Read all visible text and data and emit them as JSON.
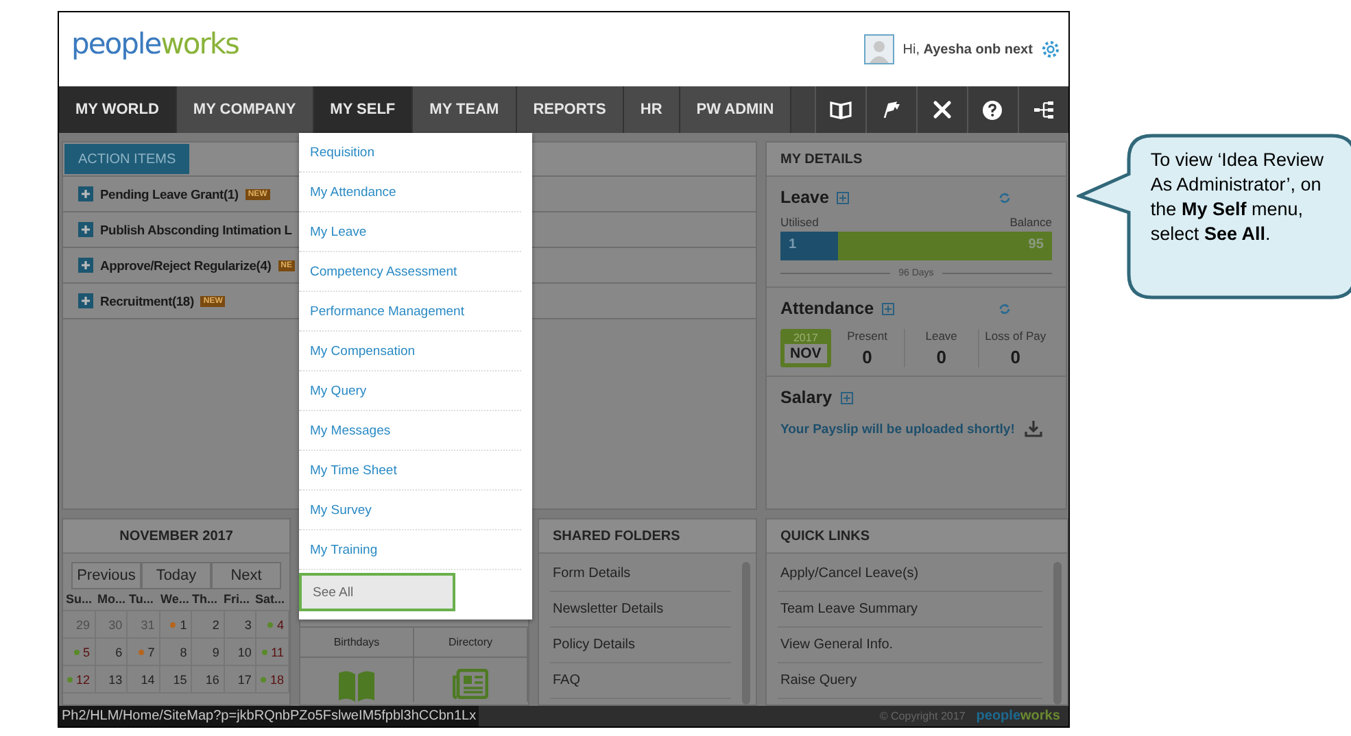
{
  "header": {
    "logo": [
      "people",
      "works"
    ],
    "greeting": "Hi, **Ayesha onb next**"
  },
  "nav": {
    "tabs": [
      {
        "label": "MY WORLD",
        "highlighted": true
      },
      {
        "label": "MY COMPANY",
        "highlighted": false
      },
      {
        "label": "MY SELF",
        "highlighted": true
      },
      {
        "label": "MY TEAM",
        "highlighted": false
      },
      {
        "label": "REPORTS",
        "highlighted": false
      },
      {
        "label": "HR",
        "highlighted": false
      },
      {
        "label": "PW ADMIN",
        "highlighted": false
      }
    ]
  },
  "action_items": {
    "tab": "ACTION ITEMS",
    "rows": [
      {
        "label": "Pending Leave Grant(1)",
        "badge": "NEW"
      },
      {
        "label": "Publish Absconding Intimation L"
      },
      {
        "label": "Approve/Reject Regularize(4)",
        "badge": "NE"
      },
      {
        "label": "Recruitment(18)",
        "badge": "NEW"
      }
    ]
  },
  "my_self_menu": {
    "items": [
      {
        "label": "Requisition",
        "selected": false
      },
      {
        "label": "My Attendance",
        "selected": false
      },
      {
        "label": "My Leave",
        "selected": false
      },
      {
        "label": "Competency Assessment",
        "selected": false
      },
      {
        "label": "Performance Management",
        "selected": false
      },
      {
        "label": "My Compensation",
        "selected": false
      },
      {
        "label": "My Query",
        "selected": false
      },
      {
        "label": "My Messages",
        "selected": false
      },
      {
        "label": "My Time Sheet",
        "selected": false
      },
      {
        "label": "My Survey",
        "selected": false
      },
      {
        "label": "My Training",
        "selected": false
      },
      {
        "label": "See All",
        "selected": true
      }
    ]
  },
  "my_details": {
    "title": "MY DETAILS",
    "leave": {
      "title": "Leave",
      "utilised_label": "Utilised",
      "balance_label": "Balance",
      "utilised": "1",
      "balance": "95",
      "level": 0.21,
      "total": "96 Days"
    },
    "attendance": {
      "title": "Attendance",
      "year": "2017",
      "month": "NOV",
      "stats": [
        {
          "label": "Present",
          "value": "0"
        },
        {
          "label": "Leave",
          "value": "0"
        },
        {
          "label": "Loss of Pay",
          "value": "0"
        }
      ]
    },
    "salary": {
      "title": "Salary",
      "message": "Your Payslip will be uploaded shortly!"
    }
  },
  "calendar": {
    "title": "NOVEMBER 2017",
    "buttons": [
      "Previous",
      "Today",
      "Next"
    ],
    "weekdays": [
      "Su...",
      "Mo...",
      "Tu...",
      "We...",
      "Th...",
      "Fri...",
      "Sat..."
    ],
    "weeks": [
      [
        {
          "day": "29",
          "muted": true,
          "weekend": true
        },
        {
          "day": "30",
          "muted": true,
          "weekend": false
        },
        {
          "day": "31",
          "muted": true,
          "weekend": false
        },
        {
          "day": "1",
          "muted": false,
          "weekend": false,
          "color": "#b5651d"
        },
        {
          "day": "2",
          "muted": false,
          "weekend": false
        },
        {
          "day": "3",
          "muted": false,
          "weekend": false
        },
        {
          "day": "4",
          "muted": false,
          "weekend": true,
          "color": "#5a8a2a"
        }
      ],
      [
        {
          "day": "5",
          "muted": false,
          "weekend": true,
          "color": "#5a8a2a"
        },
        {
          "day": "6",
          "muted": false,
          "weekend": false
        },
        {
          "day": "7",
          "muted": false,
          "weekend": false,
          "color": "#b5651d"
        },
        {
          "day": "8",
          "muted": false,
          "weekend": false
        },
        {
          "day": "9",
          "muted": false,
          "weekend": false
        },
        {
          "day": "10",
          "muted": false,
          "weekend": false
        },
        {
          "day": "11",
          "muted": false,
          "weekend": true,
          "color": "#5a8a2a"
        }
      ],
      [
        {
          "day": "12",
          "muted": false,
          "weekend": true,
          "color": "#5a8a2a"
        },
        {
          "day": "13",
          "muted": false,
          "weekend": false
        },
        {
          "day": "14",
          "muted": false,
          "weekend": false
        },
        {
          "day": "15",
          "muted": false,
          "weekend": false
        },
        {
          "day": "16",
          "muted": false,
          "weekend": false
        },
        {
          "day": "17",
          "muted": false,
          "weekend": false
        },
        {
          "day": "18",
          "muted": false,
          "weekend": true,
          "color": "#5a8a2a"
        }
      ]
    ]
  },
  "tiles": [
    {
      "label": "Birthdays"
    },
    {
      "label": "Directory"
    }
  ],
  "shared_folders": {
    "title": "SHARED FOLDERS",
    "items": [
      "Form Details",
      "Newsletter Details",
      "Policy Details",
      "FAQ"
    ]
  },
  "quick_links": {
    "title": "QUICK LINKS",
    "items": [
      "Apply/Cancel Leave(s)",
      "Team Leave Summary",
      "View General Info.",
      "Raise Query"
    ]
  },
  "footer": {
    "copyright": "© Copyright 2017",
    "logo": [
      "people",
      "works"
    ]
  },
  "status_url": "Ph2/HLM/Home/SiteMap?p=jkbRQnbPZo5FslweIM5fpbl3hCCbn1Lx",
  "callout": {
    "text": "To view ‘Idea Review As Administrator’, on the **My Self** menu, select **See All**."
  }
}
